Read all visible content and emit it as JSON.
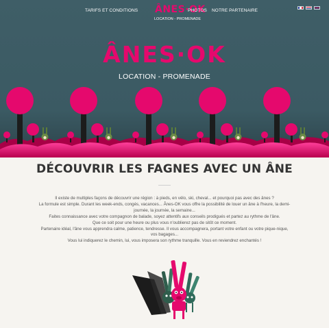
{
  "nav": {
    "left_link": "TARIFS ET CONDITIONS",
    "logo": "ÂNES·OK",
    "logo_sub": "LOCATION - PROMENADE",
    "right_links": [
      "PHOTOS",
      "NOTRE PARTENAIRE"
    ]
  },
  "languages": [
    "FR",
    "NL",
    "EN"
  ],
  "hero": {
    "title": "ÂNES·OK",
    "subtitle": "LOCATION - PROMENADE"
  },
  "section": {
    "title": "DÉCOUVRIR LES FAGNES AVEC UN ÂNE",
    "paragraphs": [
      "Il existe de multiples façons de découvrir une région : à pieds, en vélo, ski, cheval... et pourquoi pas avec des ânes ?",
      "La formule est simple. Durant les week-ends, congés, vacances... Ânes-OK vous offre la possibilité de louer un âne à l'heure, la demi-",
      "journée, la journée, la semaine...",
      "Faites connaissance avec votre compagnon de balade, soyez attentifs aux conseils prodigués et partez au rythme de l'âne.",
      "Que ce soit pour une heure ou plus vous n'oublierez pas de sitôt ce moment.",
      "Partenaire idéal, l'âne vous apprendra calme, patience, tendresse. Il vous accompagnera, portant votre enfant ou votre pique-nique,",
      "vos bagages...",
      "Vous lui indiquerez le chemin, lui, vous imposera son rythme tranquille. Vous en reviendrez enchantés !"
    ]
  },
  "colors": {
    "brand_pink": "#e5096d",
    "hero_bg": "#3b5a63",
    "page_bg": "#f6f4f0"
  }
}
